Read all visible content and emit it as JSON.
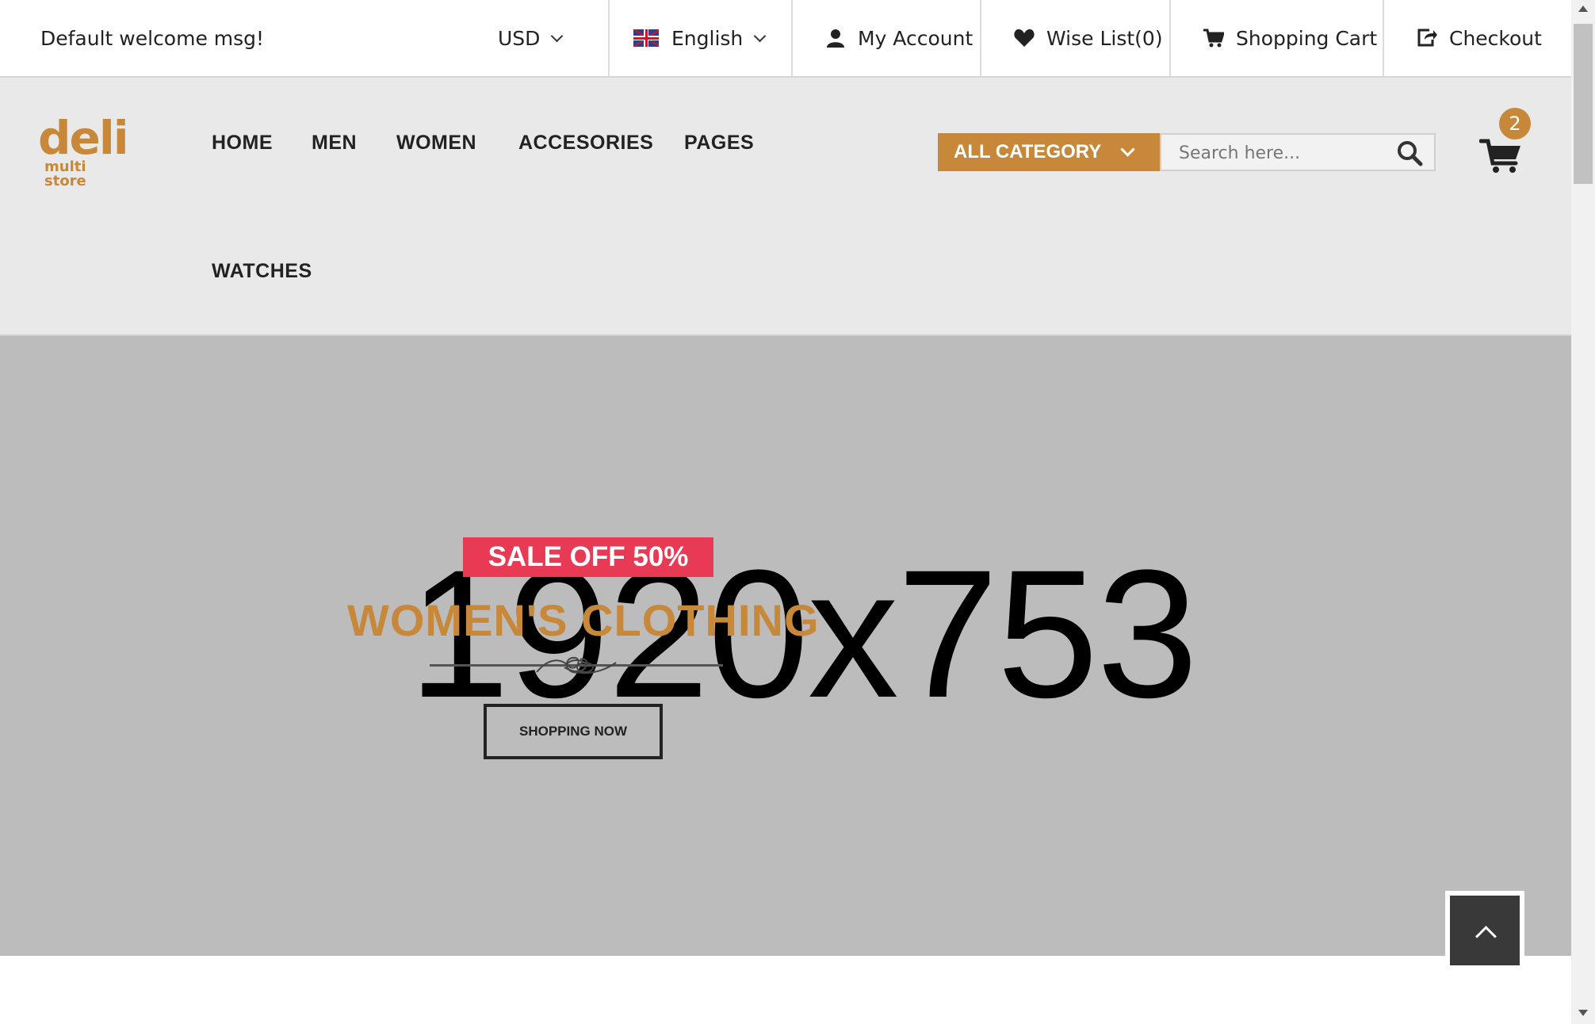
{
  "topbar": {
    "welcome": "Default welcome msg!",
    "currency": "USD",
    "language": "English",
    "my_account": "My Account",
    "wishlist": "Wise List(0)",
    "shopping_cart": "Shopping Cart",
    "checkout": "Checkout"
  },
  "header": {
    "logo_main": "deli",
    "logo_sub": "multi store",
    "nav": [
      "HOME",
      "MEN",
      "WOMEN",
      "ACCESORIES",
      "PAGES",
      "WATCHES"
    ],
    "category_label": "ALL CATEGORY",
    "search_placeholder": "Search here...",
    "cart_count": "2"
  },
  "hero": {
    "placeholder_text": "1920x753",
    "badge": "SALE OFF 50%",
    "title": "WOMEN'S CLOTHING",
    "button": "SHOPPING NOW"
  },
  "colors": {
    "accent": "#c8883a",
    "badge_red": "#e93a55",
    "hero_bg": "#bcbcbc",
    "header_bg": "#e9e9e9"
  },
  "icons": {
    "currency_dropdown": "chevron-down-icon",
    "language_flag": "uk-flag-icon",
    "account": "user-icon",
    "wishlist": "heart-icon",
    "cart": "cart-icon",
    "checkout": "share-icon",
    "search": "search-icon",
    "back_to_top": "chevron-up-icon"
  }
}
